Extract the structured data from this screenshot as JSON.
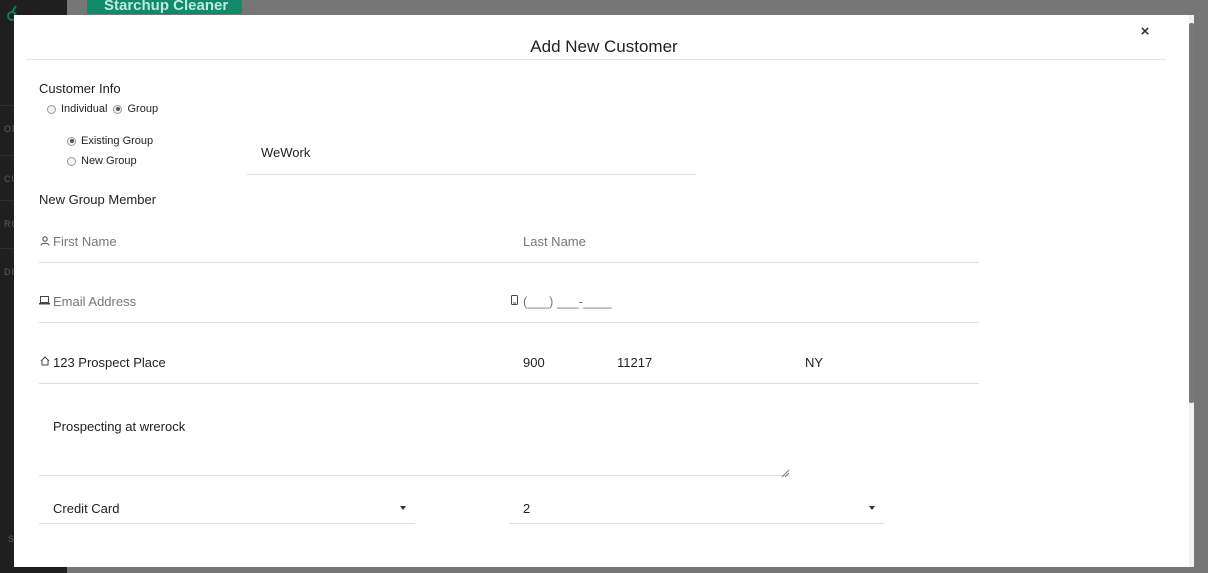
{
  "background": {
    "brand": "Starchup Cleaner",
    "nav_items": [
      "OR",
      "CUS",
      "RO",
      "DR"
    ],
    "bottom_item": "S"
  },
  "modal": {
    "title": "Add New Customer",
    "close_symbol": "×"
  },
  "customer_info": {
    "heading": "Customer Info",
    "type_options": [
      {
        "label": "Individual",
        "checked": false
      },
      {
        "label": "Group",
        "checked": true
      }
    ],
    "group_options": [
      {
        "label": "Existing Group",
        "checked": true
      },
      {
        "label": "New Group",
        "checked": false
      }
    ],
    "group_name_value": "WeWork"
  },
  "member": {
    "heading": "New Group Member",
    "first_name_placeholder": "First Name",
    "last_name_placeholder": "Last Name",
    "email_placeholder": "Email Address",
    "phone_placeholder": "(___) ___-____",
    "address_value": "123 Prospect Place",
    "apt_value": "900",
    "zip_value": "11217",
    "state_value": "NY",
    "notes_value": "Prospecting at wrerock",
    "payment_method": "Credit Card",
    "second_select_value": "2"
  },
  "icons": {
    "person": "person-icon",
    "email": "laptop-icon",
    "phone": "mobile-phone-icon",
    "home": "home-icon",
    "caret": "caret-down-icon"
  },
  "colors": {
    "brand": "#0f8a6a",
    "backdrop": "#767676",
    "sidebar": "#1f1f1f",
    "divider": "#dedede"
  }
}
